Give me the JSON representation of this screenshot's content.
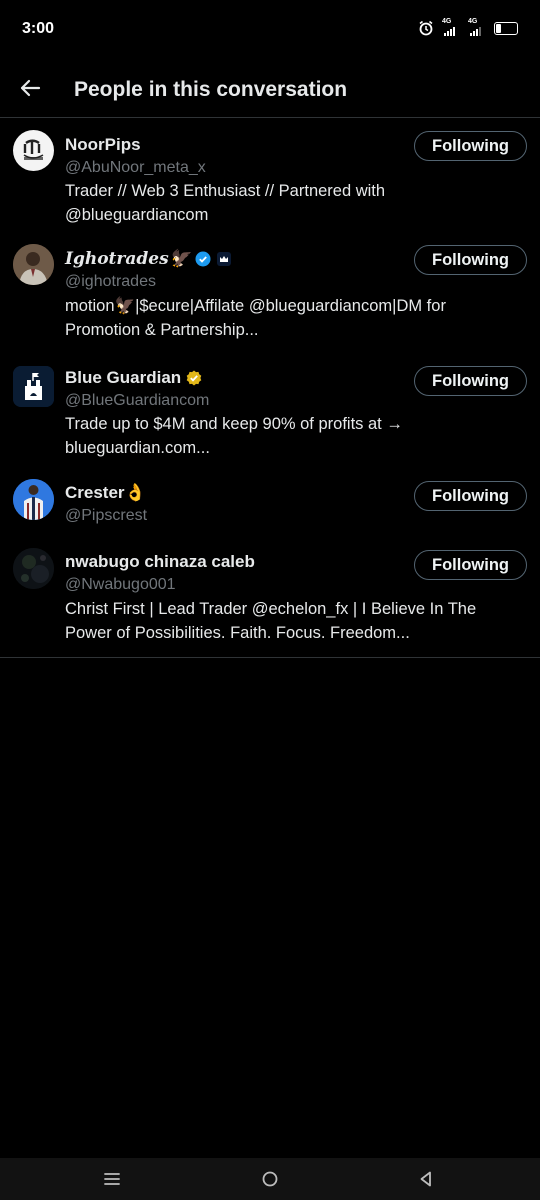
{
  "status_bar": {
    "time": "3:00",
    "network_1": "4G",
    "network_2": "4G",
    "battery": "24",
    "battery_level": 0.24
  },
  "header": {
    "title": "People in this conversation",
    "back_icon": "arrow-left-icon"
  },
  "users": [
    {
      "display_name": "NoorPips",
      "handle": "@AbuNoor_meta_x",
      "button": "Following",
      "bio_lines": [
        "Trader // Web 3 Enthusiast // Partnered with",
        "@blueguardiancom"
      ]
    },
    {
      "display_name": "Ighotrades🦅",
      "handle": "@ighotrades",
      "button": "Following",
      "badges": [
        "verified-blue-icon",
        "affiliate-icon"
      ],
      "bio_lines": [
        "motion🦅|$ecure|Affilate @blueguardiancom|DM for",
        "Promotion & Partnership..."
      ]
    },
    {
      "display_name": "Blue Guardian",
      "handle": "@BlueGuardiancom",
      "button": "Following",
      "badges": [
        "verified-gold-icon"
      ],
      "bio_lines": [
        "Trade up to $4M and keep 90% of profits at →",
        "blueguardian.com..."
      ]
    },
    {
      "display_name": "Crester👌",
      "handle": "@Pipscrest",
      "button": "Following",
      "bio_lines": []
    },
    {
      "display_name": "nwabugo chinaza caleb",
      "handle": "@Nwabugo001",
      "button": "Following",
      "bio_lines": [
        "Christ First | Lead Trader @echelon_fx | I Believe In The",
        "Power of Possibilities.  Faith. Focus. Freedom..."
      ]
    }
  ],
  "nav_bar": {
    "menu_icon": "recents-icon",
    "home_icon": "home-circle-icon",
    "back_icon": "back-triangle-icon"
  }
}
